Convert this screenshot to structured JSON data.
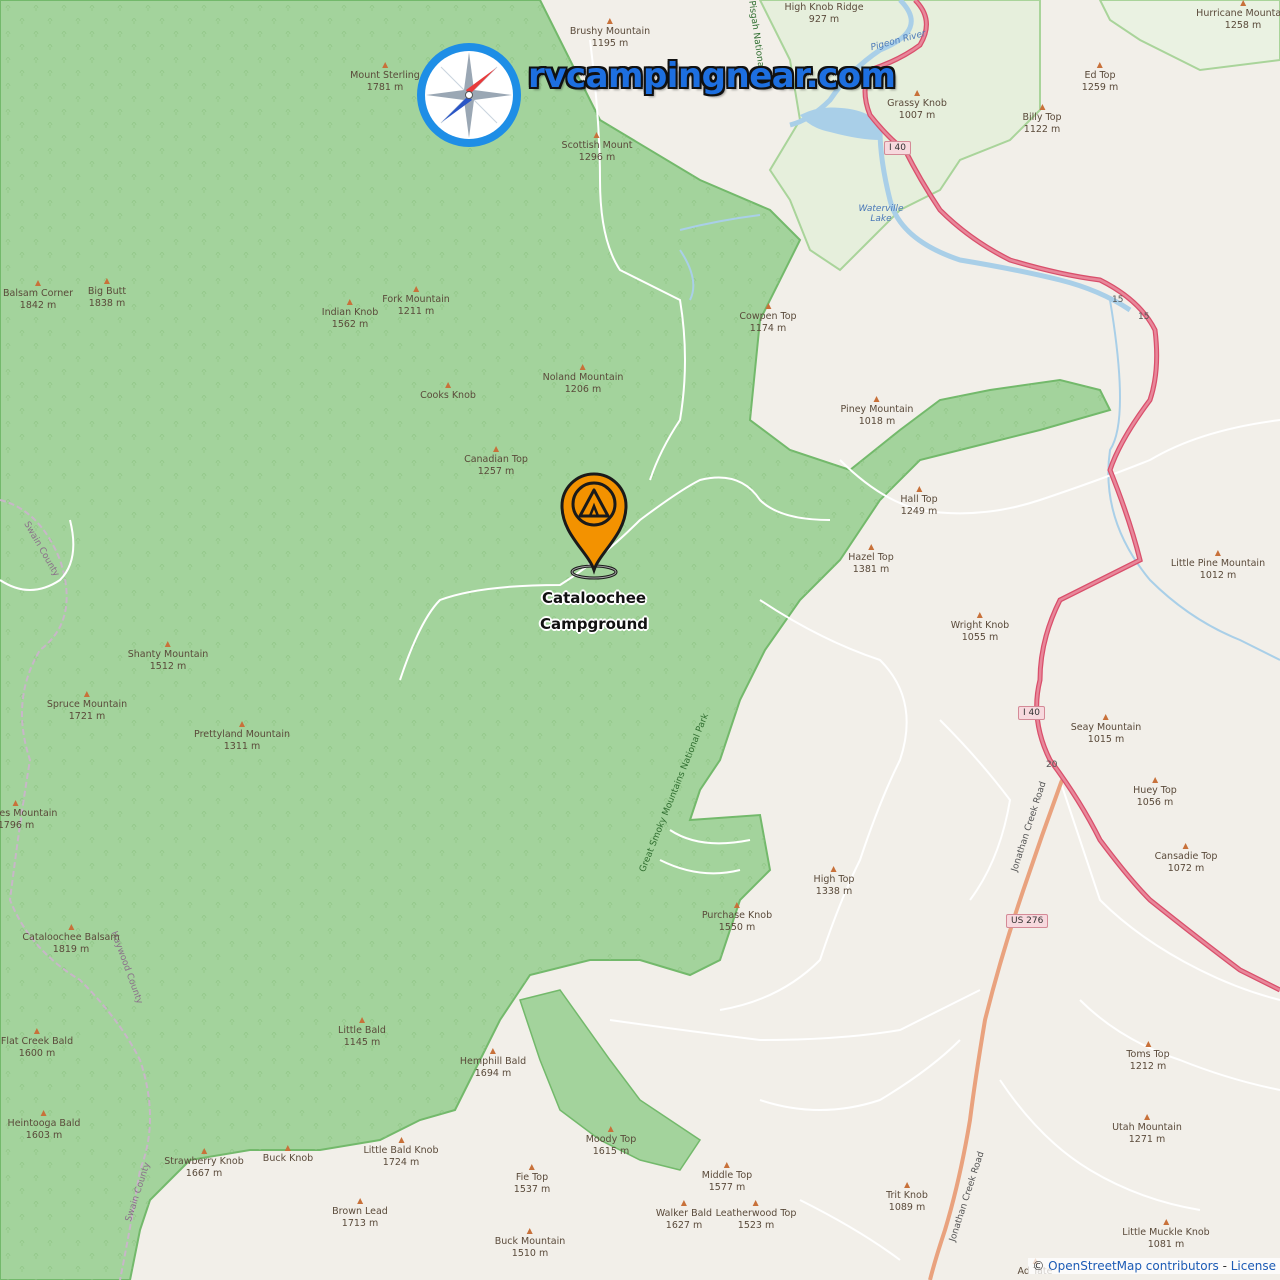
{
  "brand": {
    "name": "rvcampingnear.com",
    "logo_icon": "compass-icon"
  },
  "campground": {
    "line1": "Cataloochee",
    "line2": "Campground",
    "pin_color": "#f39200",
    "icon": "tent-pin-icon"
  },
  "colors": {
    "park": "#a3d39c",
    "park_border": "#73b96b",
    "land": "#f2efe9",
    "water": "#a9cfe8",
    "motorway": "#e1848f",
    "primary": "#f0a17a"
  },
  "park_name": "Great Smoky Mountains National Park",
  "forest_name": "Pisgah National Fo",
  "water_labels": {
    "river": "Pigeon River",
    "lake": "Waterville Lake"
  },
  "roads": {
    "i40_a": "I 40",
    "i40_b": "I 40",
    "us276": "US 276",
    "exit15a": "15",
    "exit15b": "15",
    "exit20": "20",
    "jonathan_a": "Jonathan Creek Road",
    "jonathan_b": "Jonathan Creek Road"
  },
  "counties": {
    "haywood": "Haywood County",
    "swain_a": "Swain County",
    "swain_b": "Swain County"
  },
  "peaks": [
    {
      "name": "Brushy Mountain",
      "elev": "1195 m"
    },
    {
      "name": "High Knob Ridge",
      "elev": "927 m"
    },
    {
      "name": "Hurricane Mountain",
      "elev": "1258 m"
    },
    {
      "name": "Mount Sterling",
      "elev": "1781 m"
    },
    {
      "name": "Grassy Knob",
      "elev": "1007 m"
    },
    {
      "name": "Ed Top",
      "elev": "1259 m"
    },
    {
      "name": "Billy Top",
      "elev": "1122 m"
    },
    {
      "name": "Scottish Mount",
      "elev": "1296 m"
    },
    {
      "name": "Balsam Corner",
      "elev": "1842 m"
    },
    {
      "name": "Big Butt",
      "elev": "1838 m"
    },
    {
      "name": "Fork Mountain",
      "elev": "1211 m"
    },
    {
      "name": "Indian Knob",
      "elev": "1562 m"
    },
    {
      "name": "Cowpen Top",
      "elev": "1174 m"
    },
    {
      "name": "Noland Mountain",
      "elev": "1206 m"
    },
    {
      "name": "Cooks Knob",
      "elev": ""
    },
    {
      "name": "Piney Mountain",
      "elev": "1018 m"
    },
    {
      "name": "Canadian Top",
      "elev": "1257 m"
    },
    {
      "name": "Hall Top",
      "elev": "1249 m"
    },
    {
      "name": "Hazel Top",
      "elev": "1381 m"
    },
    {
      "name": "Little Pine Mountain",
      "elev": "1012 m"
    },
    {
      "name": "Wright Knob",
      "elev": "1055 m"
    },
    {
      "name": "Shanty Mountain",
      "elev": "1512 m"
    },
    {
      "name": "Spruce Mountain",
      "elev": "1721 m"
    },
    {
      "name": "Prettyland Mountain",
      "elev": "1311 m"
    },
    {
      "name": "Seay Mountain",
      "elev": "1015 m"
    },
    {
      "name": "Chitoes Mountain",
      "elev": "1796 m"
    },
    {
      "name": "Huey Top",
      "elev": "1056 m"
    },
    {
      "name": "Cansadie Top",
      "elev": "1072 m"
    },
    {
      "name": "High Top",
      "elev": "1338 m"
    },
    {
      "name": "Purchase Knob",
      "elev": "1550 m"
    },
    {
      "name": "Cataloochee Balsam",
      "elev": "1819 m"
    },
    {
      "name": "Little Bald",
      "elev": "1145 m"
    },
    {
      "name": "Flat Creek Bald",
      "elev": "1600 m"
    },
    {
      "name": "Hemphill Bald",
      "elev": "1694 m"
    },
    {
      "name": "Toms Top",
      "elev": "1212 m"
    },
    {
      "name": "Heintooga Bald",
      "elev": "1603 m"
    },
    {
      "name": "Utah Mountain",
      "elev": "1271 m"
    },
    {
      "name": "Moody Top",
      "elev": "1615 m"
    },
    {
      "name": "Strawberry Knob",
      "elev": "1667 m"
    },
    {
      "name": "Buck Knob",
      "elev": ""
    },
    {
      "name": "Little Bald Knob",
      "elev": "1724 m"
    },
    {
      "name": "Fie Top",
      "elev": "1537 m"
    },
    {
      "name": "Middle Top",
      "elev": "1577 m"
    },
    {
      "name": "Trit Knob",
      "elev": "1089 m"
    },
    {
      "name": "Brown Lead",
      "elev": "1713 m"
    },
    {
      "name": "Walker Bald",
      "elev": "1627 m"
    },
    {
      "name": "Leatherwood Top",
      "elev": "1523 m"
    },
    {
      "name": "Buck Mountain",
      "elev": "1510 m"
    },
    {
      "name": "Little Muckle Knob",
      "elev": "1081 m"
    },
    {
      "name": "Ad Tate",
      "elev": ""
    }
  ],
  "attribution": {
    "prefix": "©",
    "osm": "OpenStreetMap contributors",
    "sep": " - ",
    "license": "License"
  }
}
